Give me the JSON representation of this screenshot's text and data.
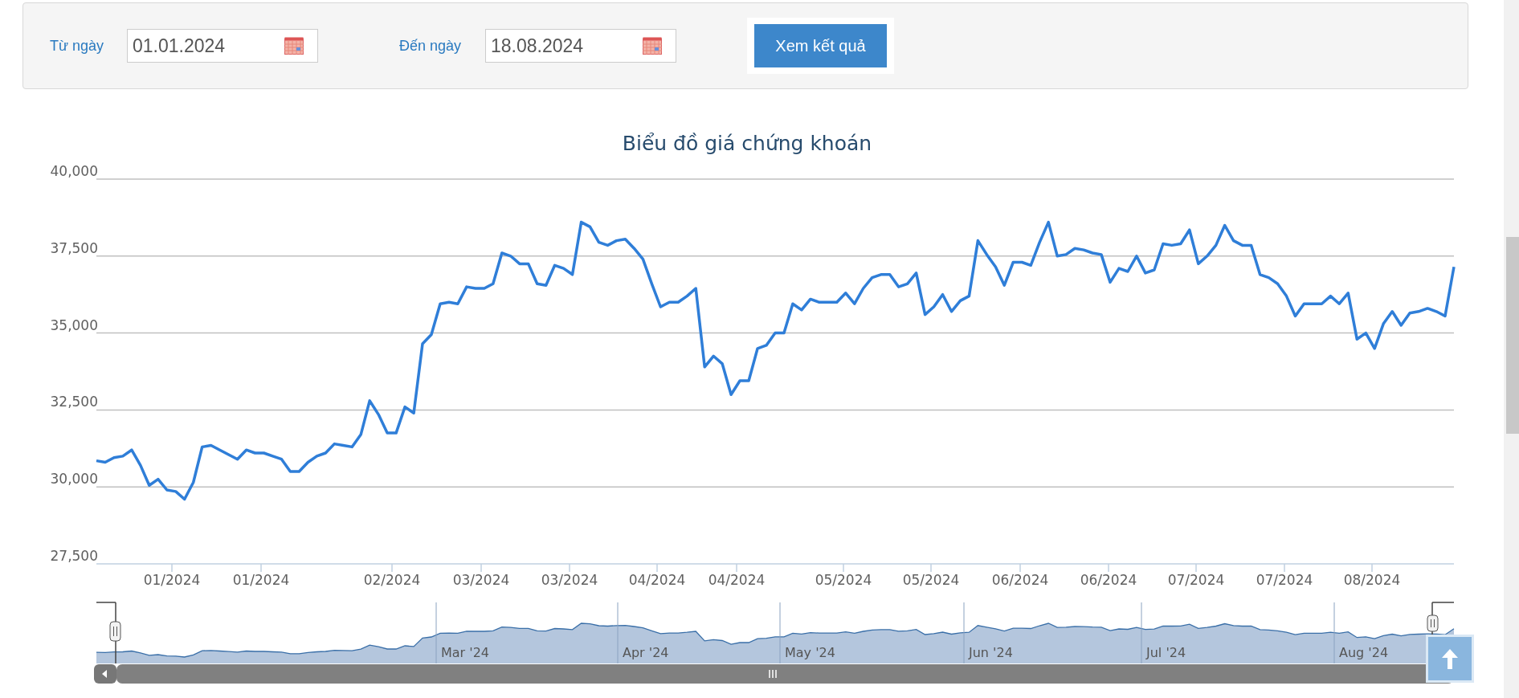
{
  "filter": {
    "from": {
      "label": "Từ ngày",
      "value": "01.01.2024"
    },
    "to": {
      "label": "Đến ngày",
      "value": "18.08.2024"
    },
    "submit": "Xem kết quả"
  },
  "chart": {
    "chart_data": {
      "type": "line",
      "title": "Biểu đồ giá chứng khoán",
      "ylim": [
        27500,
        40000
      ],
      "grid": true,
      "yticks": [
        {
          "value": 27500,
          "label": "27,500"
        },
        {
          "value": 30000,
          "label": "30,000"
        },
        {
          "value": 32500,
          "label": "32,500"
        },
        {
          "value": 35000,
          "label": "35,000"
        },
        {
          "value": 37500,
          "label": "37,500"
        },
        {
          "value": 40000,
          "label": "40,000"
        }
      ],
      "values": [
        30850,
        30800,
        30950,
        31000,
        31200,
        30700,
        30050,
        30250,
        29900,
        29850,
        29600,
        30150,
        31300,
        31350,
        31200,
        31050,
        30900,
        31200,
        31100,
        31100,
        31000,
        30900,
        30500,
        30500,
        30800,
        31000,
        31100,
        31400,
        31350,
        31300,
        31700,
        32800,
        32350,
        31750,
        31750,
        32600,
        32400,
        34650,
        34950,
        35950,
        36000,
        35950,
        36500,
        36450,
        36450,
        36600,
        37600,
        37500,
        37250,
        37250,
        36600,
        36550,
        37200,
        37100,
        36900,
        38600,
        38450,
        37950,
        37850,
        38000,
        38050,
        37750,
        37400,
        36600,
        35850,
        36000,
        36000,
        36200,
        36450,
        33900,
        34250,
        34000,
        33000,
        33450,
        33450,
        34500,
        34600,
        35000,
        35000,
        35950,
        35750,
        36100,
        36000,
        36000,
        36000,
        36300,
        35950,
        36450,
        36800,
        36900,
        36900,
        36500,
        36600,
        36950,
        35600,
        35850,
        36250,
        35700,
        36050,
        36200,
        38000,
        37550,
        37150,
        36550,
        37300,
        37300,
        37200,
        37950,
        38600,
        37500,
        37550,
        37750,
        37700,
        37600,
        37550,
        36650,
        37100,
        37000,
        37500,
        36950,
        37050,
        37900,
        37850,
        37900,
        38350,
        37250,
        37500,
        37850,
        38500,
        38000,
        37850,
        37850,
        36900,
        36800,
        36600,
        36200,
        35550,
        35950,
        35950,
        35950,
        36200,
        35950,
        36300,
        34800,
        35000,
        34500,
        35300,
        35700,
        35250,
        35650,
        35700,
        35800,
        35700,
        35550,
        37150
      ]
    },
    "x_axis_labels": [
      "01/2024",
      "01/2024",
      "02/2024",
      "03/2024",
      "03/2024",
      "04/2024",
      "04/2024",
      "05/2024",
      "05/2024",
      "06/2024",
      "06/2024",
      "07/2024",
      "07/2024",
      "08/2024"
    ]
  },
  "navigator": {
    "labels": [
      "Mar '24",
      "Apr '24",
      "May '24",
      "Jun '24",
      "Jul '24",
      "Aug '24"
    ]
  }
}
